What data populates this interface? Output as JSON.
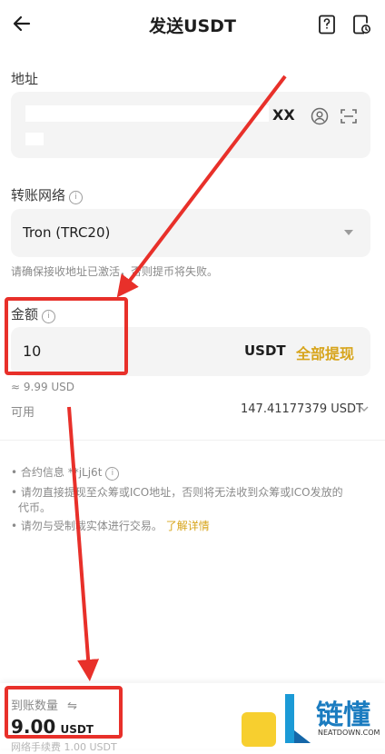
{
  "header": {
    "title": "发送USDT"
  },
  "address": {
    "label": "地址",
    "visible_suffix": "XX"
  },
  "network": {
    "label": "转账网络",
    "value": "Tron (TRC20)",
    "warning": "请确保接收地址已激活，否则提币将失败。"
  },
  "amount": {
    "label": "金额",
    "value": "10",
    "currency": "USDT",
    "max_label": "全部提现",
    "approx": "≈ 9.99 USD",
    "available_label": "可用",
    "available_value": "147.41177379 USDT"
  },
  "notices": {
    "contract": "• 合约信息 **jLj6t",
    "ico_1": "• 请勿直接提现至众筹或ICO地址，否则将无法收到众筹或ICO发放的",
    "ico_2": "代币。",
    "sanction": "• 请勿与受制裁实体进行交易。",
    "learn_more": "了解详情"
  },
  "footer": {
    "receive_label": "到账数量",
    "receive_value": "9.00",
    "receive_unit": "USDT",
    "fee_text": "网络手续费 1.00 USDT"
  },
  "watermark": {
    "brand": "链懂",
    "site": "NEATDOWN.COM"
  },
  "colors": {
    "accent_gold": "#d7a41a",
    "annotation_red": "#e8302a"
  }
}
